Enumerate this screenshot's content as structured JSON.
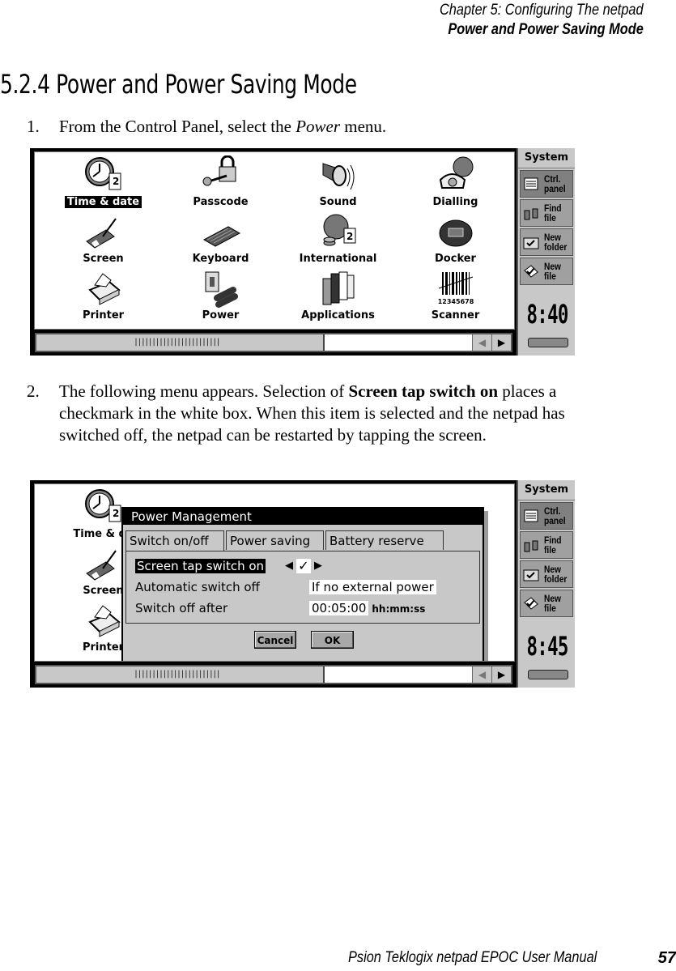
{
  "header": {
    "chapter": "Chapter 5:  Configuring The netpad",
    "section": "Power and Power Saving Mode"
  },
  "section_title": "5.2.4  Power and Power Saving Mode",
  "steps": [
    {
      "number": "1.",
      "text_before": "From the Control Panel, select the ",
      "emphasis": "Power",
      "text_after": " menu."
    },
    {
      "number": "2.",
      "text_before": "The following menu appears. Selection of ",
      "emphasis": "Screen tap switch on",
      "text_after": " places a checkmark in the white box. When this item is selected and the netpad has switched off, the netpad can be restarted by tapping the screen."
    }
  ],
  "screenshot1": {
    "icons": [
      {
        "label": "Time & date",
        "icon": "clock-icon",
        "selected": true
      },
      {
        "label": "Passcode",
        "icon": "padlock-key-icon"
      },
      {
        "label": "Sound",
        "icon": "speaker-icon"
      },
      {
        "label": "Dialling",
        "icon": "telephone-globe-icon"
      },
      {
        "label": "Screen",
        "icon": "touchscreen-pen-icon"
      },
      {
        "label": "Keyboard",
        "icon": "keyboard-icon"
      },
      {
        "label": "International",
        "icon": "globe-coins-icon"
      },
      {
        "label": "Docker",
        "icon": "docker-icon"
      },
      {
        "label": "Printer",
        "icon": "printer-icon"
      },
      {
        "label": "Power",
        "icon": "battery-switch-icon"
      },
      {
        "label": "Applications",
        "icon": "books-icon"
      },
      {
        "label": "Scanner",
        "icon": "barcode-icon",
        "barcode_text": "12345678"
      }
    ],
    "sidebar": {
      "title": "System",
      "buttons": [
        {
          "label": "Ctrl.\npanel",
          "icon": "control-panel-icon",
          "active": true
        },
        {
          "label": "Find\nfile",
          "icon": "binoculars-icon"
        },
        {
          "label": "New\nfolder",
          "icon": "folder-check-icon"
        },
        {
          "label": "New\nfile",
          "icon": "file-check-icon"
        }
      ],
      "clock": "8:40"
    },
    "scroll_left": "◀",
    "scroll_right": "▶",
    "grip": "||||||||||||||||||||||||"
  },
  "screenshot2": {
    "background_labels": [
      "Time & da",
      "Screen",
      "Printer"
    ],
    "dialog": {
      "title": "Power Management",
      "tabs": [
        "Switch on/off",
        "Power saving",
        "Battery reserve"
      ],
      "active_tab": 0,
      "rows": [
        {
          "label": "Screen tap switch on",
          "selected": true,
          "control": "checkbox",
          "checked": true,
          "check_glyph": "✓",
          "left_arrow": "◀",
          "right_arrow": "▶"
        },
        {
          "label": "Automatic switch off",
          "value": "If no external power"
        },
        {
          "label": "Switch off after",
          "value": "00:05:00",
          "unit": "hh:mm:ss"
        }
      ],
      "buttons": {
        "cancel": "Cancel",
        "ok": "OK"
      }
    },
    "sidebar": {
      "title": "System",
      "buttons": [
        {
          "label": "Ctrl.\npanel",
          "active": true
        },
        {
          "label": "Find\nfile"
        },
        {
          "label": "New\nfolder"
        },
        {
          "label": "New\nfile"
        }
      ],
      "clock": "8:45"
    }
  },
  "footer": {
    "manual": "Psion Teklogix netpad EPOC User Manual",
    "page": "57"
  }
}
